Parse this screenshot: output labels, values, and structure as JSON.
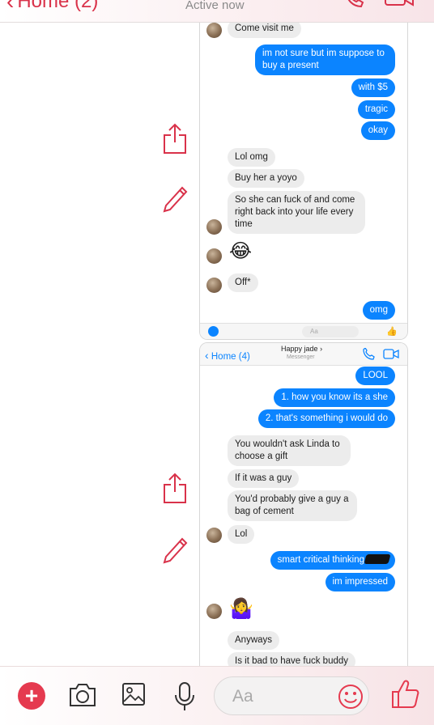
{
  "outer_header": {
    "back_label": "Home (2)",
    "status": "Active now",
    "accent": "#d9324a"
  },
  "conversation_top": {
    "messages": [
      {
        "dir": "in",
        "text": "Come visit me",
        "avatar": true
      },
      {
        "dir": "out",
        "text": "im not sure but im suppose to buy a present"
      },
      {
        "dir": "out",
        "text": "with $5"
      },
      {
        "dir": "out",
        "text": "tragic"
      },
      {
        "dir": "out",
        "text": "okay"
      },
      {
        "dir": "in",
        "text": "Lol omg"
      },
      {
        "dir": "in",
        "text": "Buy her a yoyo"
      },
      {
        "dir": "in",
        "text": "So she can fuck of and come right back into your life every time",
        "avatar": true
      },
      {
        "dir": "in",
        "text": "😂",
        "avatar": true
      },
      {
        "dir": "in",
        "text": "Off*",
        "avatar": true
      },
      {
        "dir": "out",
        "text": "omg"
      }
    ],
    "composer_placeholder": "Aa"
  },
  "conversation_bottom": {
    "header": {
      "back_label": "Home (4)",
      "contact_name": "Happy jade",
      "chevron": "›",
      "subtitle": "Messenger"
    },
    "messages": [
      {
        "dir": "out",
        "text": "LOOL"
      },
      {
        "dir": "out",
        "text": "1. how you know its a she"
      },
      {
        "dir": "out",
        "text": "2. that's something i would do"
      },
      {
        "dir": "in",
        "text": "You wouldn't ask Linda to choose a gift"
      },
      {
        "dir": "in",
        "text": "If it was a guy"
      },
      {
        "dir": "in",
        "text": "You'd probably give a guy a bag of cement"
      },
      {
        "dir": "in",
        "text": "Lol",
        "avatar": true
      },
      {
        "dir": "out",
        "text": "smart critical thinking"
      },
      {
        "dir": "out",
        "text": "im impressed"
      },
      {
        "dir": "in",
        "text": "🤷‍♀️",
        "avatar": true
      },
      {
        "dir": "in",
        "text": "Anyways"
      },
      {
        "dir": "in",
        "text": "Is it bad to have fuck buddy"
      }
    ]
  },
  "side_tools": {
    "icons": [
      "share-icon",
      "pencil-icon",
      "share-icon",
      "pencil-icon"
    ]
  },
  "composer": {
    "placeholder": "Aa",
    "icons": [
      "plus-icon",
      "camera-icon",
      "image-icon",
      "microphone-icon",
      "emoji-icon",
      "thumbs-up-icon"
    ]
  },
  "colors": {
    "outgoing": "#0b84ff",
    "incoming": "#ececec",
    "accent": "#e53a4f"
  }
}
